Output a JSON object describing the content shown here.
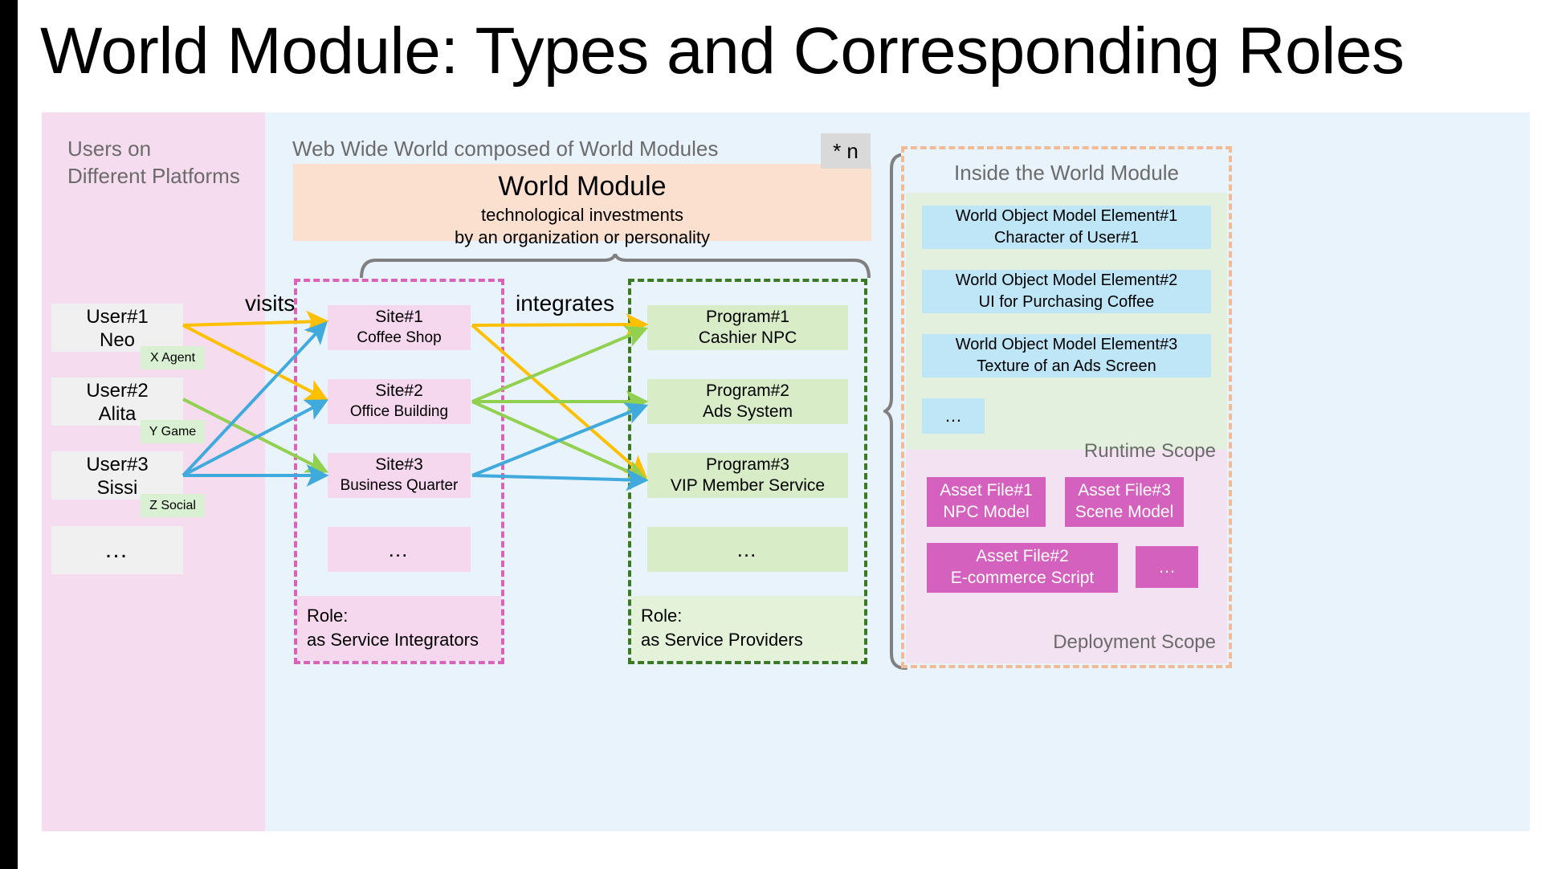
{
  "title": "World Module: Types and Corresponding Roles",
  "panels": {
    "users_caption_line1": "Users on",
    "users_caption_line2": "Different Platforms",
    "www_caption": "Web Wide World composed of World Modules"
  },
  "world_module": {
    "title": "World Module",
    "subtitle_line1": "technological investments",
    "subtitle_line2": "by an organization or personality",
    "multiplicity_badge": "* n"
  },
  "users": [
    {
      "id": "User#1",
      "name": "Neo",
      "platform": "X Agent"
    },
    {
      "id": "User#2",
      "name": "Alita",
      "platform": "Y Game"
    },
    {
      "id": "User#3",
      "name": "Sissi",
      "platform": "Z Social"
    },
    {
      "id": "…",
      "name": "",
      "platform": ""
    }
  ],
  "edges": {
    "visits_label": "visits",
    "integrates_label": "integrates",
    "visits": [
      {
        "from": "User#1",
        "to": "Site#1",
        "color": "#FFC000"
      },
      {
        "from": "User#1",
        "to": "Site#2",
        "color": "#FFC000"
      },
      {
        "from": "User#2",
        "to": "Site#3",
        "color": "#92D050"
      },
      {
        "from": "User#3",
        "to": "Site#1",
        "color": "#41AADC"
      },
      {
        "from": "User#3",
        "to": "Site#2",
        "color": "#41AADC"
      },
      {
        "from": "User#3",
        "to": "Site#3",
        "color": "#41AADC"
      }
    ],
    "integrates": [
      {
        "from": "Site#1",
        "to": "Program#1",
        "color": "#FFC000"
      },
      {
        "from": "Site#1",
        "to": "Program#3",
        "color": "#FFC000"
      },
      {
        "from": "Site#2",
        "to": "Program#1",
        "color": "#92D050"
      },
      {
        "from": "Site#2",
        "to": "Program#2",
        "color": "#92D050"
      },
      {
        "from": "Site#2",
        "to": "Program#3",
        "color": "#92D050"
      },
      {
        "from": "Site#3",
        "to": "Program#2",
        "color": "#41AADC"
      },
      {
        "from": "Site#3",
        "to": "Program#3",
        "color": "#41AADC"
      }
    ]
  },
  "sites": {
    "items": [
      {
        "id": "Site#1",
        "name": "Coffee Shop"
      },
      {
        "id": "Site#2",
        "name": "Office Building"
      },
      {
        "id": "Site#3",
        "name": "Business Quarter"
      },
      {
        "id": "…",
        "name": ""
      }
    ],
    "role_line1": "Role:",
    "role_line2": "as Service Integrators"
  },
  "programs": {
    "items": [
      {
        "id": "Program#1",
        "name": "Cashier NPC"
      },
      {
        "id": "Program#2",
        "name": "Ads System"
      },
      {
        "id": "Program#3",
        "name": "VIP Member Service"
      },
      {
        "id": "…",
        "name": ""
      }
    ],
    "role_line1": "Role:",
    "role_line2": "as Service Providers"
  },
  "inside": {
    "title": "Inside the World Module",
    "runtime_scope_label": "Runtime Scope",
    "deployment_scope_label": "Deployment Scope",
    "world_object_models": [
      {
        "id": "World Object Model Element#1",
        "name": "Character of User#1"
      },
      {
        "id": "World Object Model Element#2",
        "name": "UI for Purchasing Coffee"
      },
      {
        "id": "World Object Model Element#3",
        "name": "Texture of an Ads Screen"
      },
      {
        "id": "…",
        "name": ""
      }
    ],
    "assets": [
      {
        "id": "Asset File#1",
        "name": "NPC Model"
      },
      {
        "id": "Asset File#3",
        "name": "Scene Model"
      },
      {
        "id": "Asset File#2",
        "name": "E-commerce Script"
      },
      {
        "id": "…",
        "name": ""
      }
    ]
  },
  "colors": {
    "users_panel": "#f6dcef",
    "www_panel": "#e9f3fc",
    "world_module_box": "#fbe0d0",
    "site_card": "#f5d7ee",
    "program_card": "#d8ecc8",
    "wom_card": "#bfe6f7",
    "asset_card": "#d361bd",
    "sites_group_border": "#d963b8",
    "programs_group_border": "#3b7a25",
    "inside_border": "#f2bb98",
    "arrow_orange": "#FFC000",
    "arrow_green": "#92D050",
    "arrow_blue": "#41AADC",
    "brace": "#808080"
  }
}
